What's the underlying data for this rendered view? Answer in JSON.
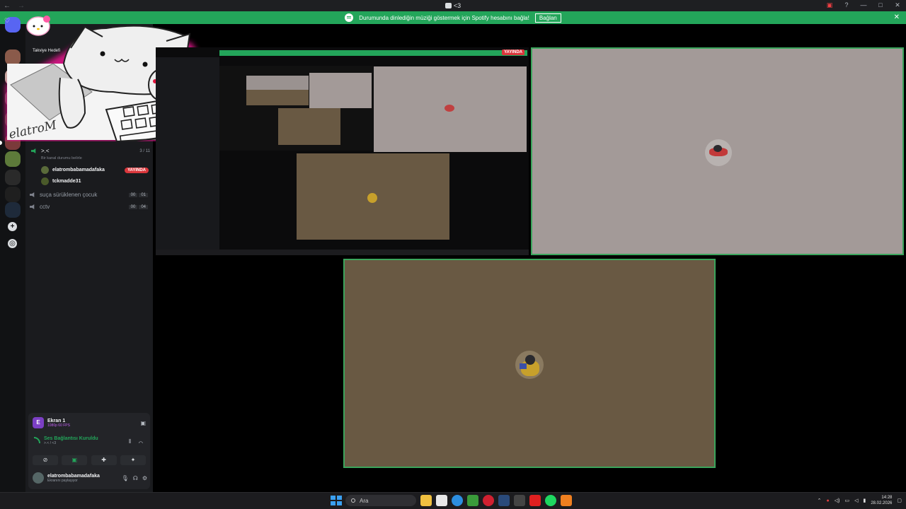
{
  "window": {
    "title": "<3",
    "nav_back": "←",
    "nav_fwd": "→"
  },
  "banner": {
    "message": "Durumunda dinlediğin müziği göstermek için Spotify hesabını bağla!",
    "connect_label": "Bağlan",
    "close_label": "✕"
  },
  "sidebar": {
    "boost_label": "Takviye Hedefi",
    "active_channel": {
      "name": ">.<",
      "count": "3 / 11",
      "status": "Bir kanal durumu belirle"
    },
    "members": [
      {
        "name": "elatrombabamadafaka",
        "badge": "YAYINDA"
      },
      {
        "name": "tckmadde31",
        "badge": ""
      }
    ],
    "channels": [
      {
        "name": "suça sürüklenen çocuk",
        "c1": "00",
        "c2": "01"
      },
      {
        "name": "cctv",
        "c1": "00",
        "c2": "04"
      }
    ]
  },
  "voice_panel": {
    "stream_name": "Ekran 1",
    "stream_quality": "1080p 60 FPS",
    "connection_status": "Ses Bağlantısı Kuruldu",
    "connection_sub": ">.< / <3",
    "user_name": "elatrombabamadafaka",
    "user_status": "Ekranını paylaşıyor"
  },
  "sticker": {
    "signature": "elatroM",
    "logo": "Hello Kitty"
  },
  "tiles": {
    "live_label": "YAYINDA"
  },
  "taskbar": {
    "search_placeholder": "Ara",
    "time": "14:28",
    "date": "28.02.2026"
  },
  "colors": {
    "green": "#23a55a",
    "live_red": "#da373c",
    "sidebar": "#1a1b1e",
    "rail": "#111214"
  }
}
